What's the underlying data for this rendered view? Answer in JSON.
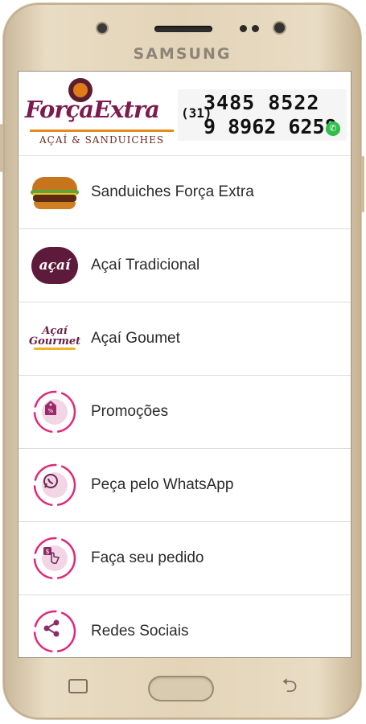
{
  "device": {
    "brand": "SAMSUNG"
  },
  "header": {
    "logo_title": "ForçaExtra",
    "logo_subtitle": "AÇAÍ & SANDUICHES",
    "area_code": "(31)",
    "phone_1": "3485 8522",
    "phone_2": "9 8962 6258"
  },
  "menu": {
    "items": [
      {
        "label": "Sanduiches Força Extra",
        "icon": "burger-icon"
      },
      {
        "label": "Açaí Tradicional",
        "icon": "acai-logo-icon",
        "icon_text": "açaí"
      },
      {
        "label": "Açaí Goumet",
        "icon": "acai-gourmet-logo-icon",
        "icon_text": "Açaí Gourmet"
      },
      {
        "label": "Promoções",
        "icon": "price-tag-icon"
      },
      {
        "label": "Peça pelo WhatsApp",
        "icon": "whatsapp-icon"
      },
      {
        "label": "Faça seu pedido",
        "icon": "tap-order-icon"
      },
      {
        "label": "Redes Sociais",
        "icon": "share-icon"
      }
    ]
  },
  "colors": {
    "accent": "#e0287a",
    "brand": "#7b1c4e",
    "bezel": "#e3d4b8"
  }
}
